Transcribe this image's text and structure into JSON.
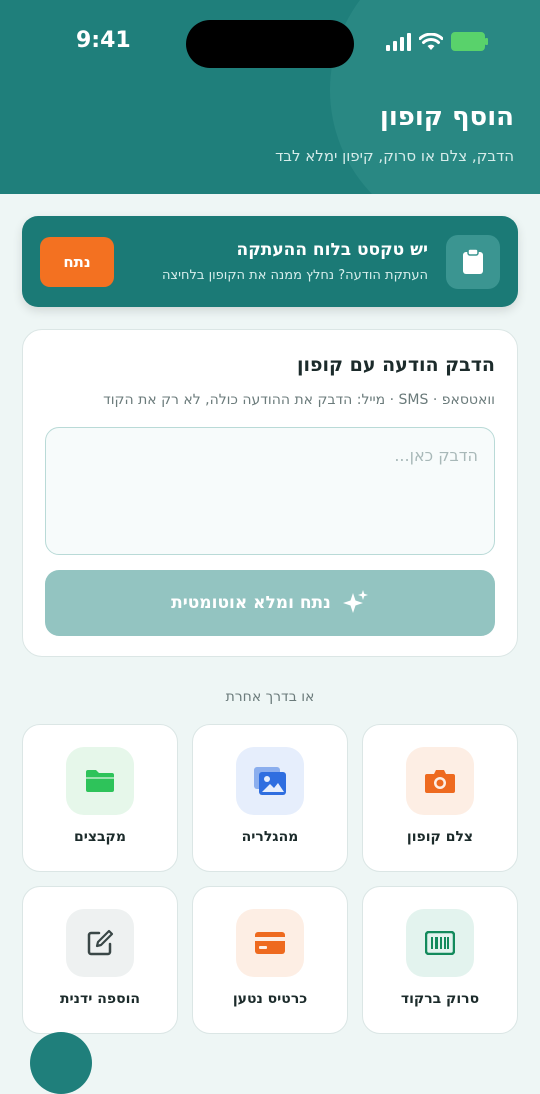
{
  "status_bar": {
    "time": "9:41"
  },
  "header": {
    "title": "הוסף קופון",
    "subtitle": "הדבק, צלם או סרוק, קיפון ימלא לבד"
  },
  "clipboard": {
    "title": "יש טקסט בלוח ההעתקה",
    "subtitle": "העתקת הודעה? נחלץ ממנה את הקופון בלחיצה",
    "button_label": "נתח"
  },
  "paste_card": {
    "title": "הדבק הודעה עם קופון",
    "subtitle": "וואטסאפ · SMS · מייל: הדבק את ההודעה כולה, לא רק את הקוד",
    "placeholder": "הדבק כאן...",
    "button_label": "נתח ומלא אוטומטית"
  },
  "or_label": "או בדרך אחרת",
  "options": [
    {
      "label": "צלם קופון",
      "icon": "camera-icon",
      "color": "#ee6a1f",
      "bg": "#fdeee4"
    },
    {
      "label": "מהגלריה",
      "icon": "gallery-icon",
      "color": "#2f6ee0",
      "bg": "#e6eefc"
    },
    {
      "label": "מקבצים",
      "icon": "folder-icon",
      "color": "#2ec35a",
      "bg": "#e6f7ea"
    },
    {
      "label": "סרוק ברקוד",
      "icon": "barcode-icon",
      "color": "#138a5c",
      "bg": "#e3f3ee"
    },
    {
      "label": "כרטיס נטען",
      "icon": "card-icon",
      "color": "#ee6a1f",
      "bg": "#fdeee4"
    },
    {
      "label": "הוספה ידנית",
      "icon": "edit-icon",
      "color": "#3a4747",
      "bg": "#eef1f1"
    }
  ],
  "colors": {
    "primary": "#1f7f7b",
    "accent": "#f37121"
  }
}
